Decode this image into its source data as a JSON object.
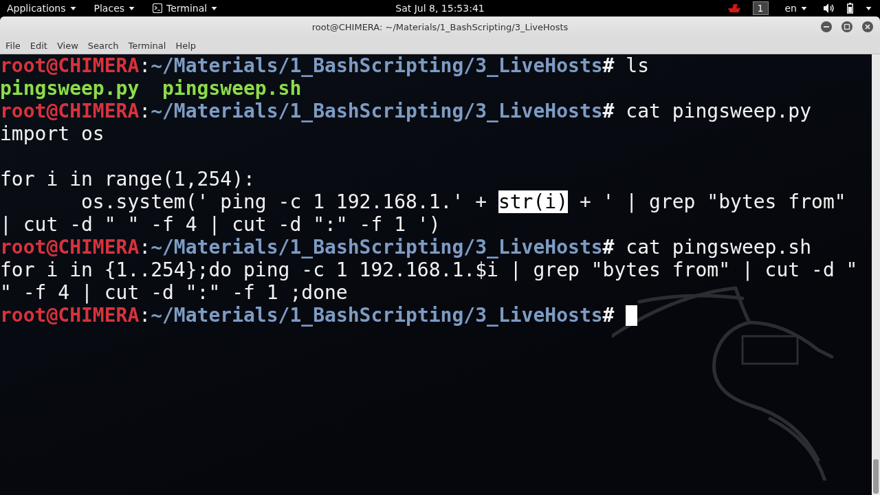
{
  "top_bar": {
    "menus": [
      {
        "label": "Applications",
        "icon": false
      },
      {
        "label": "Places",
        "icon": false
      },
      {
        "label": "Terminal",
        "icon": true
      }
    ],
    "clock": "Sat Jul  8, 15:53:41",
    "workspace": "1",
    "language": "en"
  },
  "window": {
    "title": "root@CHIMERA: ~/Materials/1_BashScripting/3_LiveHosts"
  },
  "menu_bar": [
    "File",
    "Edit",
    "View",
    "Search",
    "Terminal",
    "Help"
  ],
  "terminal": {
    "lines": [
      {
        "segments": [
          {
            "kind": "user",
            "text": "root@CHIMERA"
          },
          {
            "kind": "plain",
            "text": ":"
          },
          {
            "kind": "path",
            "text": "~/Materials/1_BashScripting/3_LiveHosts"
          },
          {
            "kind": "hash",
            "text": "# "
          },
          {
            "kind": "plain",
            "text": "ls"
          }
        ]
      },
      {
        "segments": [
          {
            "kind": "file",
            "text": "pingsweep.py  pingsweep.sh"
          }
        ]
      },
      {
        "segments": [
          {
            "kind": "user",
            "text": "root@CHIMERA"
          },
          {
            "kind": "plain",
            "text": ":"
          },
          {
            "kind": "path",
            "text": "~/Materials/1_BashScripting/3_LiveHosts"
          },
          {
            "kind": "hash",
            "text": "# "
          },
          {
            "kind": "plain",
            "text": "cat pingsweep.py"
          }
        ]
      },
      {
        "segments": [
          {
            "kind": "plain",
            "text": "import os"
          }
        ]
      },
      {
        "segments": [
          {
            "kind": "plain",
            "text": "\nfor i in range(1,254):"
          }
        ]
      },
      {
        "segments": [
          {
            "kind": "plain",
            "text": "       os.system(' ping -c 1 192.168.1.' + "
          },
          {
            "kind": "selection",
            "text": "str(i)"
          },
          {
            "kind": "plain",
            "text": " + ' | grep \"bytes from\""
          }
        ]
      },
      {
        "segments": [
          {
            "kind": "plain",
            "text": "| cut -d \" \" -f 4 | cut -d \":\" -f 1 ')"
          }
        ]
      },
      {
        "segments": [
          {
            "kind": "user",
            "text": "root@CHIMERA"
          },
          {
            "kind": "plain",
            "text": ":"
          },
          {
            "kind": "path",
            "text": "~/Materials/1_BashScripting/3_LiveHosts"
          },
          {
            "kind": "hash",
            "text": "# "
          },
          {
            "kind": "plain",
            "text": "cat pingsweep.sh"
          }
        ]
      },
      {
        "segments": [
          {
            "kind": "plain",
            "text": "for i in {1..254};do ping -c 1 192.168.1.$i | grep \"bytes from\" | cut -d \""
          }
        ]
      },
      {
        "segments": [
          {
            "kind": "plain",
            "text": "\" -f 4 | cut -d \":\" -f 1 ;done"
          }
        ]
      },
      {
        "segments": [
          {
            "kind": "user",
            "text": "root@CHIMERA"
          },
          {
            "kind": "plain",
            "text": ":"
          },
          {
            "kind": "path",
            "text": "~/Materials/1_BashScripting/3_LiveHosts"
          },
          {
            "kind": "hash",
            "text": "# "
          }
        ],
        "cursor": true
      }
    ]
  }
}
